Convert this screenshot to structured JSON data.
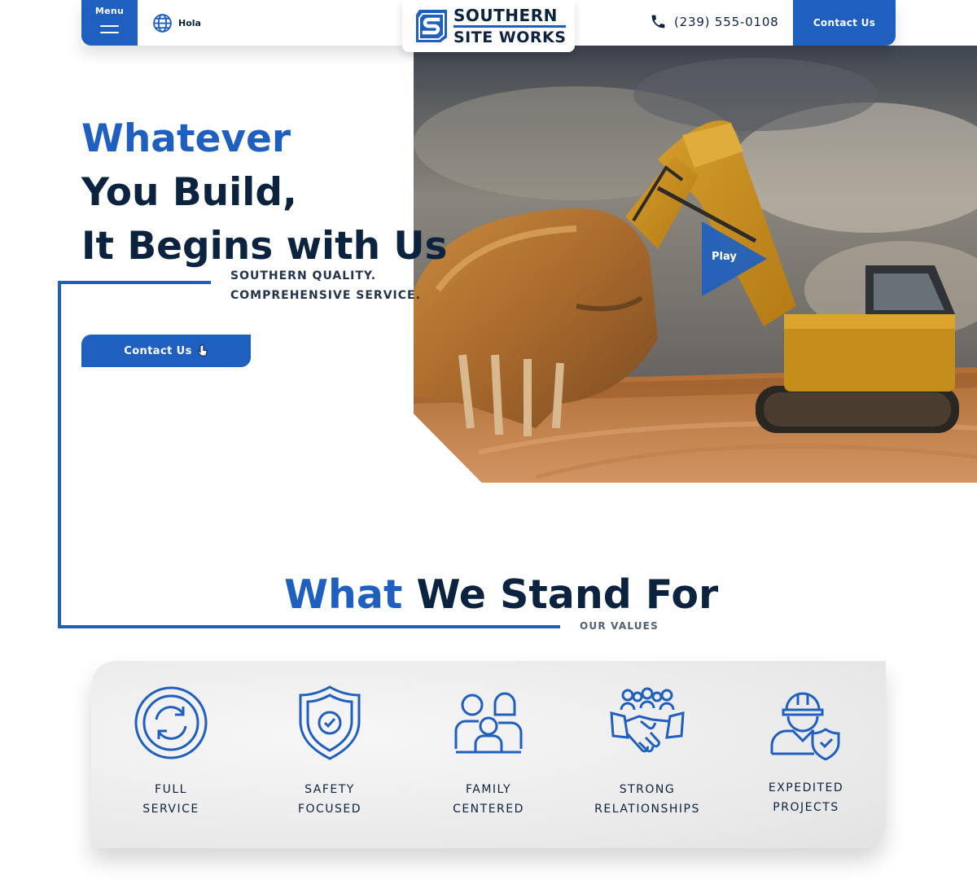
{
  "header": {
    "menu_label": "Menu",
    "language_label": "Hola",
    "logo_line1": "SOUTHERN",
    "logo_line2": "SITE WORKS",
    "phone": "(239) 555-0108",
    "contact_label": "Contact Us"
  },
  "hero": {
    "headline_line1": "Whatever",
    "headline_line2": "You Build,",
    "headline_line3": "It Begins with Us",
    "tagline_line1": "SOUTHERN QUALITY.",
    "tagline_line2": "COMPREHENSIVE SERVICE.",
    "cta_label": "Contact Us",
    "play_label": "Play"
  },
  "values": {
    "title_part1": "What",
    "title_part2": "We Stand For",
    "subtitle": "OUR VALUES",
    "items": [
      {
        "line1": "FULL",
        "line2": "SERVICE",
        "icon": "refresh-circle-icon"
      },
      {
        "line1": "SAFETY",
        "line2": "FOCUSED",
        "icon": "shield-check-icon"
      },
      {
        "line1": "FAMILY",
        "line2": "CENTERED",
        "icon": "family-icon"
      },
      {
        "line1": "STRONG",
        "line2": "RELATIONSHIPS",
        "icon": "handshake-icon"
      },
      {
        "line1": "EXPEDITED",
        "line2": "PROJECTS",
        "icon": "worker-icon"
      }
    ]
  },
  "colors": {
    "brand_blue": "#1f5fbf",
    "navy": "#0c2340"
  }
}
